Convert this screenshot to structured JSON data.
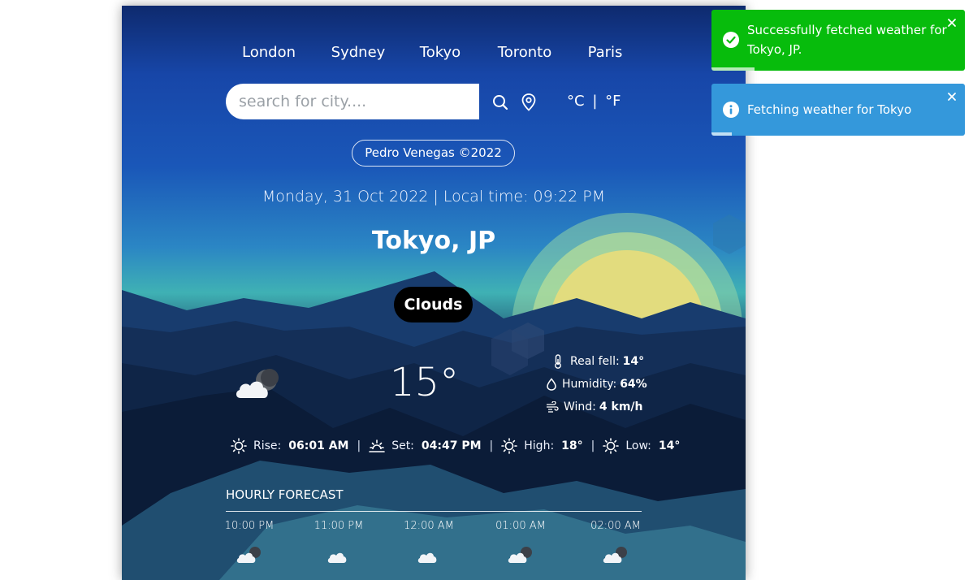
{
  "cities": [
    "London",
    "Sydney",
    "Tokyo",
    "Toronto",
    "Paris"
  ],
  "search": {
    "placeholder": "search for city...."
  },
  "units": {
    "celsius": "°C",
    "separator": "|",
    "fahrenheit": "°F"
  },
  "credit": "Pedro Venegas ©2022",
  "datetime": "Monday, 31 Oct 2022 | Local time: 09:22 PM",
  "location": "Tokyo, JP",
  "condition": "Clouds",
  "current": {
    "temp": "15°",
    "real_feel_label": "Real fell:",
    "real_feel": "14°",
    "humidity_label": "Humidity:",
    "humidity": "64%",
    "wind_label": "Wind:",
    "wind": "4 km/h",
    "icon": "cloud-night-icon"
  },
  "sun": {
    "rise_label": "Rise:",
    "rise": "06:01 AM",
    "set_label": "Set:",
    "set": "04:47 PM",
    "high_label": "High:",
    "high": "18°",
    "low_label": "Low:",
    "low": "14°",
    "separator": "|"
  },
  "forecast": {
    "title": "HOURLY FORECAST",
    "hours": [
      {
        "time": "10:00 PM",
        "icon": "cloud-night-icon"
      },
      {
        "time": "11:00 PM",
        "icon": "cloud-icon"
      },
      {
        "time": "12:00 AM",
        "icon": "cloud-icon"
      },
      {
        "time": "01:00 AM",
        "icon": "cloud-night-icon"
      },
      {
        "time": "02:00 AM",
        "icon": "cloud-night-icon"
      }
    ]
  },
  "toasts": [
    {
      "type": "success",
      "message_line1": "Successfully fetched weather for",
      "message_line2": "Tokyo, JP.",
      "color": "#07bc0c",
      "progress": 0.17
    },
    {
      "type": "info",
      "message": "Fetching weather for Tokyo",
      "color": "#3498db",
      "progress": 0.08
    }
  ],
  "colors": {
    "toast_success": "#07bc0c",
    "toast_info": "#3498db",
    "sun": "#e6dc7c"
  }
}
